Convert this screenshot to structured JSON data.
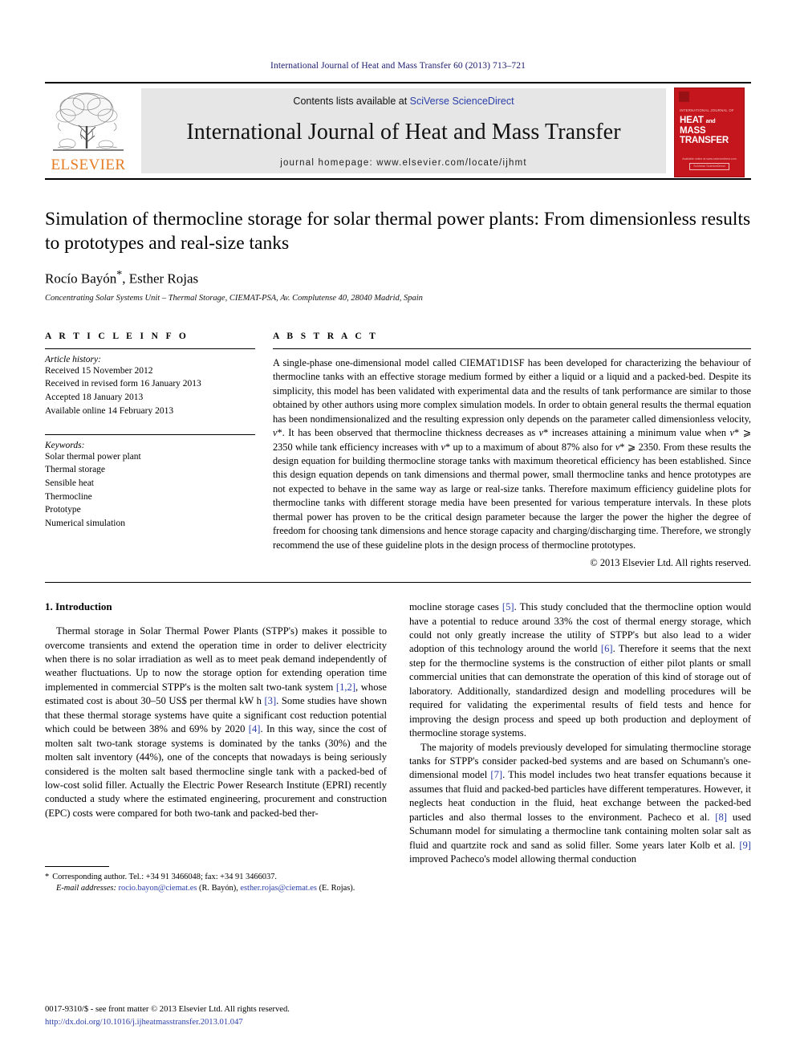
{
  "running_head": "International Journal of Heat and Mass Transfer 60 (2013) 713–721",
  "masthead": {
    "publisher_name": "ELSEVIER",
    "contents_prefix": "Contents lists available at ",
    "contents_link": "SciVerse ScienceDirect",
    "journal_title": "International Journal of Heat and Mass Transfer",
    "homepage": "journal homepage: www.elsevier.com/locate/ijhmt",
    "cover": {
      "overline": "INTERNATIONAL JOURNAL OF",
      "line1": "HEAT",
      "and": "and",
      "line2": "MASS",
      "line3": "TRANSFER",
      "footer_text": "Available online at www.sciencedirect.com",
      "footer_badge": "SciVerse ScienceDirect"
    },
    "colors": {
      "link_blue": "#2a3ea8",
      "elsevier_orange": "#E77B21",
      "cover_red": "#c4161c",
      "banner_grey": "#e6e6e6"
    }
  },
  "article": {
    "title": "Simulation of thermocline storage for solar thermal power plants: From dimensionless results to prototypes and real-size tanks",
    "authors": "Rocío Bayón",
    "authors_star": "*",
    "authors_rest": ", Esther Rojas",
    "affiliation": "Concentrating Solar Systems Unit – Thermal Storage, CIEMAT-PSA, Av. Complutense 40, 28040 Madrid, Spain"
  },
  "article_info": {
    "heading": "A R T I C L E    I N F O",
    "history_label": "Article history:",
    "history": [
      "Received 15 November 2012",
      "Received in revised form 16 January 2013",
      "Accepted 18 January 2013",
      "Available online 14 February 2013"
    ],
    "keywords_label": "Keywords:",
    "keywords": [
      "Solar thermal power plant",
      "Thermal storage",
      "Sensible heat",
      "Thermocline",
      "Prototype",
      "Numerical simulation"
    ]
  },
  "abstract": {
    "heading": "A B S T R A C T",
    "text": "A single-phase one-dimensional model called CIEMAT1D1SF has been developed for characterizing the behaviour of thermocline tanks with an effective storage medium formed by either a liquid or a liquid and a packed-bed. Despite its simplicity, this model has been validated with experimental data and the results of tank performance are similar to those obtained by other authors using more complex simulation models. In order to obtain general results the thermal equation has been nondimensionalized and the resulting expression only depends on the parameter called dimensionless velocity, v*. It has been observed that thermocline thickness decreases as v* increases attaining a minimum value when v* ⩾ 2350 while tank efficiency increases with v* up to a maximum of about 87% also for v* ⩾ 2350. From these results the design equation for building thermocline storage tanks with maximum theoretical efficiency has been established. Since this design equation depends on tank dimensions and thermal power, small thermocline tanks and hence prototypes are not expected to behave in the same way as large or real-size tanks. Therefore maximum efficiency guideline plots for thermocline tanks with different storage media have been presented for various temperature intervals. In these plots thermal power has proven to be the critical design parameter because the larger the power the higher the degree of freedom for choosing tank dimensions and hence storage capacity and charging/discharging time. Therefore, we strongly recommend the use of these guideline plots in the design process of thermocline prototypes.",
    "copyright": "© 2013 Elsevier Ltd. All rights reserved."
  },
  "body": {
    "section_number_title": "1. Introduction",
    "left_paragraphs": [
      "Thermal storage in Solar Thermal Power Plants (STPP's) makes it possible to overcome transients and extend the operation time in order to deliver electricity when there is no solar irradiation as well as to meet peak demand independently of weather fluctuations. Up to now the storage option for extending operation time implemented in commercial STPP's is the molten salt two-tank system [1,2], whose estimated cost is about 30–50 US$ per thermal kW h [3]. Some studies have shown that these thermal storage systems have quite a significant cost reduction potential which could be between 38% and 69% by 2020 [4]. In this way, since the cost of molten salt two-tank storage systems is dominated by the tanks (30%) and the molten salt inventory (44%), one of the concepts that nowadays is being seriously considered is the molten salt based thermocline single tank with a packed-bed of low-cost solid filler. Actually the Electric Power Research Institute (EPRI) recently conducted a study where the estimated engineering, procurement and construction (EPC) costs were compared for both two-tank and packed-bed ther-"
    ],
    "right_paragraphs": [
      "mocline storage cases [5]. This study concluded that the thermocline option would have a potential to reduce around 33% the cost of thermal energy storage, which could not only greatly increase the utility of STPP's but also lead to a wider adoption of this technology around the world [6]. Therefore it seems that the next step for the thermocline systems is the construction of either pilot plants or small commercial unities that can demonstrate the operation of this kind of storage out of laboratory. Additionally, standardized design and modelling procedures will be required for validating the experimental results of field tests and hence for improving the design process and speed up both production and deployment of thermocline storage systems.",
      "The majority of models previously developed for simulating thermocline storage tanks for STPP's consider packed-bed systems and are based on Schumann's one-dimensional model [7]. This model includes two heat transfer equations because it assumes that fluid and packed-bed particles have different temperatures. However, it neglects heat conduction in the fluid, heat exchange between the packed-bed particles and also thermal losses to the environment. Pacheco et al. [8] used Schumann model for simulating a thermocline tank containing molten solar salt as fluid and quartzite rock and sand as solid filler. Some years later Kolb et al. [9] improved Pacheco's model allowing thermal conduction"
    ]
  },
  "footnote": {
    "star": "*",
    "corresponding": "Corresponding author. Tel.: +34 91 3466048; fax: +34 91 3466037.",
    "email_label": "E-mail addresses:",
    "email1": "rocio.bayon@ciemat.es",
    "email1_owner": "(R. Bayón),",
    "email2": "esther.rojas@ciemat.es",
    "email2_owner": "(E. Rojas)."
  },
  "page_footer": {
    "issn_line": "0017-9310/$ - see front matter © 2013 Elsevier Ltd. All rights reserved.",
    "doi": "http://dx.doi.org/10.1016/j.ijheatmasstransfer.2013.01.047"
  }
}
